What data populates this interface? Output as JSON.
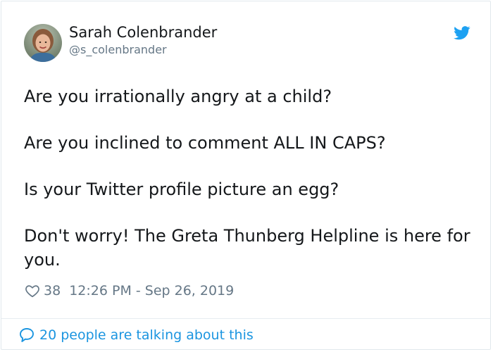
{
  "author": {
    "name": "Sarah Colenbrander",
    "handle": "@s_colenbrander",
    "avatar_icon": "profile-photo"
  },
  "brand": {
    "icon": "twitter-bird-icon",
    "color": "#1da1f2"
  },
  "tweet": {
    "paragraphs": [
      "Are you irrationally angry at a child?",
      "Are you inclined to comment ALL IN CAPS?",
      "Is your Twitter profile picture an egg?",
      "Don't worry! The Greta Thunberg Helpline is here for you."
    ]
  },
  "meta": {
    "likes": "38",
    "timestamp": "12:26 PM - Sep 26, 2019",
    "heart_icon": "heart-outline-icon"
  },
  "footer": {
    "talking_label": "20 people are talking about this",
    "bubble_icon": "speech-bubble-icon",
    "color": "#1b95e0"
  }
}
